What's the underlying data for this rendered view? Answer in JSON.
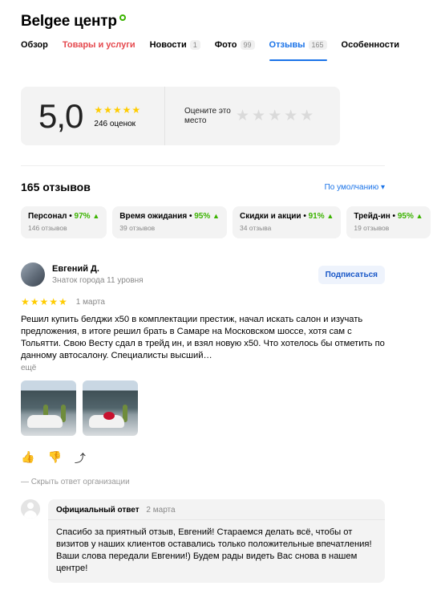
{
  "org": {
    "name": "Belgee центр"
  },
  "tabs": [
    {
      "label": "Обзор",
      "count": null
    },
    {
      "label": "Товары и услуги",
      "count": null
    },
    {
      "label": "Новости",
      "count": "1"
    },
    {
      "label": "Фото",
      "count": "99"
    },
    {
      "label": "Отзывы",
      "count": "165"
    },
    {
      "label": "Особенности",
      "count": null
    }
  ],
  "rating": {
    "score": "5,0",
    "stars": "★★★★★",
    "count_label": "246 оценок",
    "rate_prompt": "Оцените это место",
    "rate_stars": "★★★★★"
  },
  "reviews": {
    "title": "165 отзывов",
    "sort_label": "По умолчанию ▾"
  },
  "aspects": [
    {
      "name": "Персонал",
      "percent": "97%",
      "reviews": "146 отзывов"
    },
    {
      "name": "Время ожидания",
      "percent": "95%",
      "reviews": "39 отзывов"
    },
    {
      "name": "Скидки и акции",
      "percent": "91%",
      "reviews": "34 отзыва"
    },
    {
      "name": "Трейд-ин",
      "percent": "95%",
      "reviews": "19 отзывов"
    }
  ],
  "review": {
    "author": "Евгений Д.",
    "level": "Знаток города 11 уровня",
    "subscribe": "Подписаться",
    "stars": "★★★★★",
    "date": "1 марта",
    "text": "Решил купить белджи х50 в комплектации престиж, начал искать салон и изучать предложения, в итоге решил брать в Самаре на Московском шоссе, хотя сам с Тольятти. Свою Весту сдал в трейд ин, и взял новую х50. Что хотелось бы отметить по данному автосалону. Специалисты высший…",
    "more": "ещё",
    "hide_answer": "— Скрыть ответ организации"
  },
  "answer": {
    "title": "Официальный ответ",
    "date": "2 марта",
    "text": "Спасибо за приятный отзыв, Евгений! Стараемся делать всё, чтобы от визитов у наших клиентов оставались только положительные впечатления! Ваши слова передали Евгении!) Будем рады видеть Вас снова в нашем центре!"
  },
  "icons": {
    "like": "👍",
    "dislike": "👎",
    "share": "⤴"
  },
  "colors": {
    "accent": "#1a73e8",
    "highlight_tab": "#e5484d",
    "positive": "#3bb300",
    "star": "#ffcc00"
  }
}
